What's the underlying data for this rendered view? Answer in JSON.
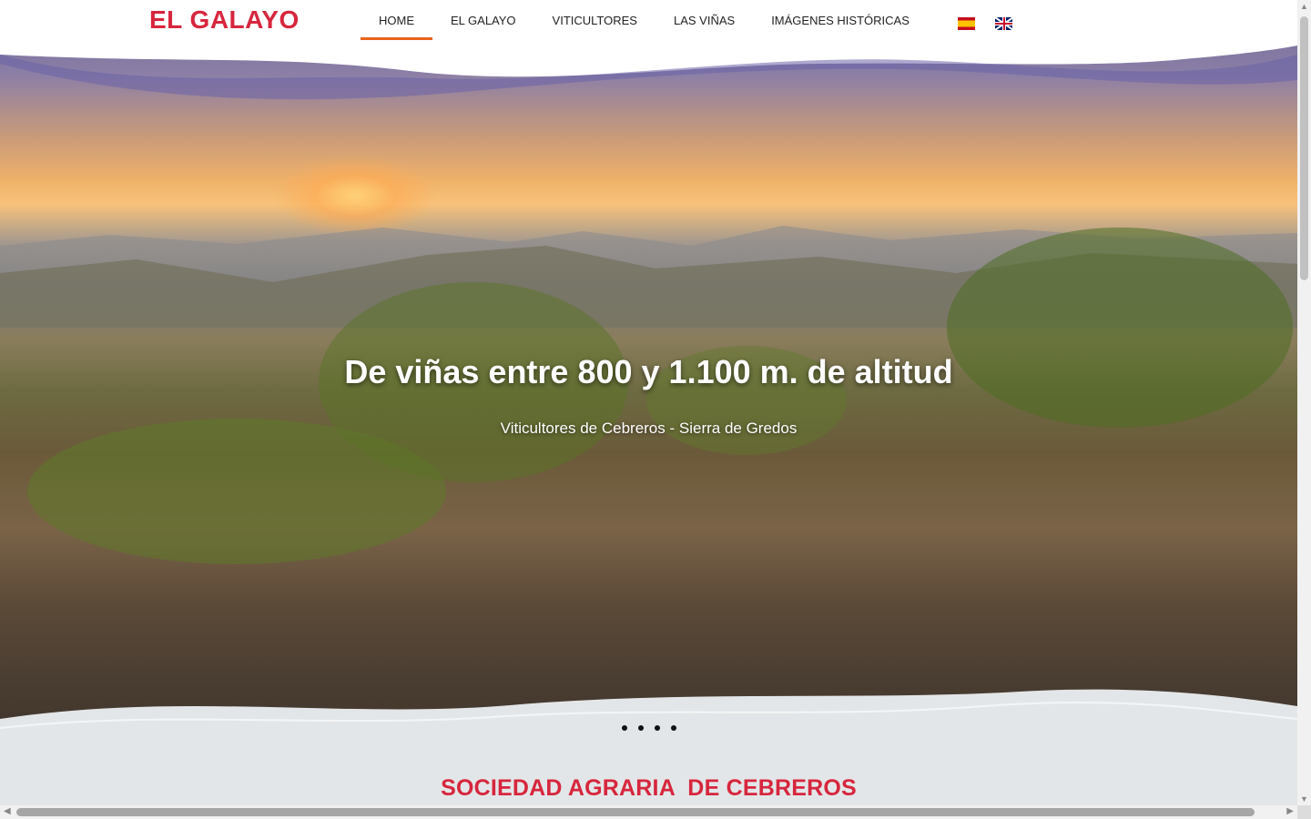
{
  "header": {
    "logo_text": "EL GALAYO",
    "nav": [
      {
        "label": "HOME",
        "active": true
      },
      {
        "label": "EL GALAYO",
        "active": false
      },
      {
        "label": "VITICULTORES",
        "active": false
      },
      {
        "label": "LAS VIÑAS",
        "active": false
      },
      {
        "label": "IMÁGENES HISTÓRICAS",
        "active": false
      }
    ],
    "languages": [
      "es-flag-icon",
      "gb-flag-icon"
    ]
  },
  "hero": {
    "title": "De viñas entre 800 y 1.100 m. de altitud",
    "subtitle": "Viticultores de Cebreros - Sierra de Gredos",
    "slide_count": 4
  },
  "section": {
    "title": "SOCIEDAD AGRARIA  DE CEBREROS"
  },
  "colors": {
    "brand_red": "#d7263d",
    "nav_active_underline": "#e8641b",
    "section_bg": "#e3e6e8"
  }
}
